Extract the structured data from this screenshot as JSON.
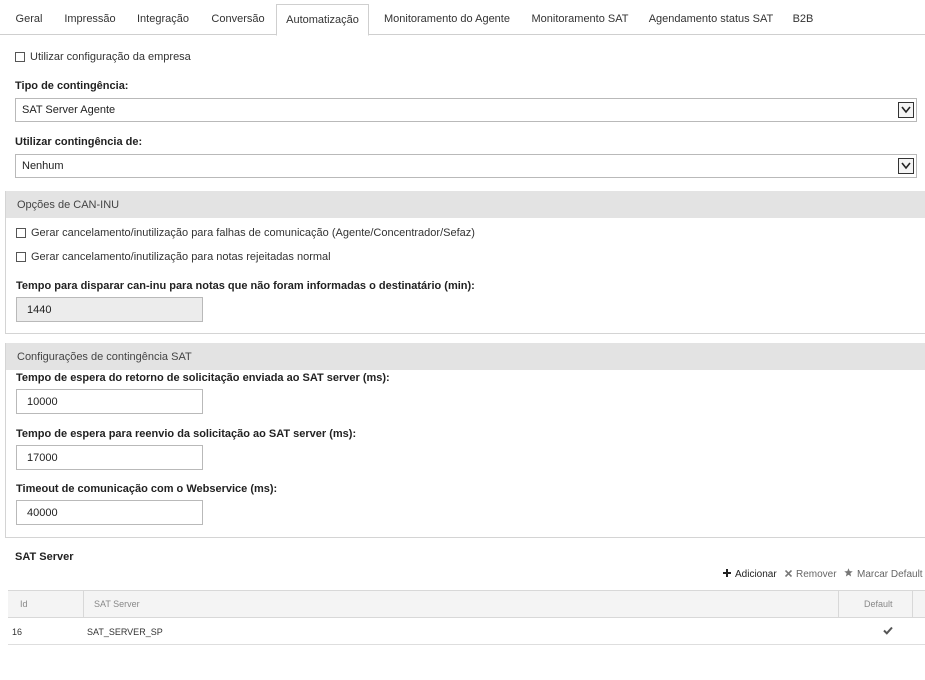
{
  "tabs": [
    {
      "label": "Geral",
      "active": false
    },
    {
      "label": "Impressão",
      "active": false
    },
    {
      "label": "Integração",
      "active": false
    },
    {
      "label": "Conversão",
      "active": false
    },
    {
      "label": "Automatização",
      "active": true
    },
    {
      "label": "Monitoramento do Agente",
      "active": false
    },
    {
      "label": "Monitoramento SAT",
      "active": false
    },
    {
      "label": "Agendamento status SAT",
      "active": false
    },
    {
      "label": "B2B",
      "active": false
    }
  ],
  "company_config": {
    "label": "Utilizar configuração da empresa",
    "checked": false
  },
  "contingency_type": {
    "label": "Tipo de contingência:",
    "value": "SAT Server Agente"
  },
  "use_contingency": {
    "label": "Utilizar contingência de:",
    "value": "Nenhum"
  },
  "can_inu": {
    "title": "Opções de CAN-INU",
    "option_comm_failure": {
      "label": "Gerar cancelamento/inutilização para falhas de comunicação (Agente/Concentrador/Sefaz)",
      "checked": false
    },
    "option_rejected": {
      "label": "Gerar cancelamento/inutilização para notas rejeitadas normal",
      "checked": false
    },
    "time_label": "Tempo para disparar can-inu para notas que não foram informadas o destinatário (min):",
    "time_value": "1440"
  },
  "sat_contingency": {
    "title": "Configurações de contingência SAT",
    "return_wait_label": "Tempo de espera do retorno de solicitação enviada ao SAT server (ms):",
    "return_wait_value": "10000",
    "resend_wait_label": "Tempo de espera para reenvio da solicitação ao SAT server (ms):",
    "resend_wait_value": "17000",
    "webservice_timeout_label": "Timeout de comunicação com o Webservice (ms):",
    "webservice_timeout_value": "40000"
  },
  "sat_server": {
    "title": "SAT Server",
    "toolbar": {
      "add": "Adicionar",
      "remove": "Remover",
      "mark_default": "Marcar Default"
    },
    "columns": {
      "id": "Id",
      "server": "SAT Server",
      "default": "Default"
    },
    "rows": [
      {
        "id": "16",
        "server": "SAT_SERVER_SP",
        "default": true
      }
    ]
  }
}
